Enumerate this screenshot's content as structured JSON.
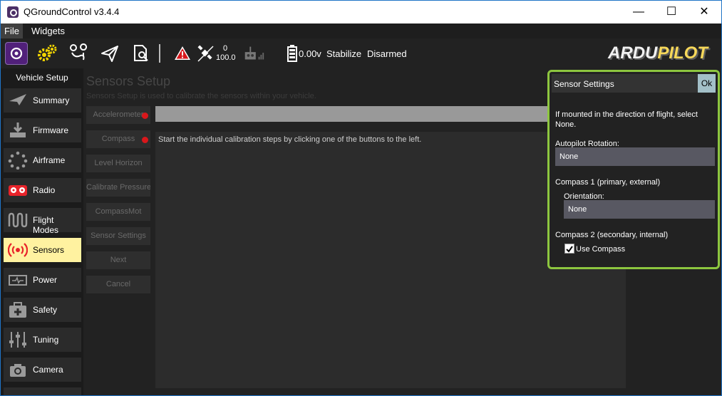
{
  "window": {
    "title": "QGroundControl v3.4.4"
  },
  "menu": {
    "items": [
      "File",
      "Widgets"
    ]
  },
  "toolbar": {
    "satellites": "0",
    "hdop": "100.0",
    "battery": "0.00v",
    "flight_mode": "Stabilize",
    "arm_state": "Disarmed",
    "brand_ardu": "ARDU",
    "brand_pilot": "PILOT"
  },
  "sidebar": {
    "header": "Vehicle Setup",
    "items": [
      {
        "label": "Summary"
      },
      {
        "label": "Firmware"
      },
      {
        "label": "Airframe"
      },
      {
        "label": "Radio"
      },
      {
        "label": "Flight Modes"
      },
      {
        "label": "Sensors"
      },
      {
        "label": "Power"
      },
      {
        "label": "Safety"
      },
      {
        "label": "Tuning"
      },
      {
        "label": "Camera"
      }
    ]
  },
  "main": {
    "title": "Sensors Setup",
    "description": "Sensors Setup is used to calibrate the sensors within your vehicle.",
    "buttons": [
      "Accelerometer",
      "Compass",
      "Level Horizon",
      "Calibrate Pressure",
      "CompassMot",
      "Sensor Settings",
      "Next",
      "Cancel"
    ],
    "status_text": "Start the individual calibration steps by clicking one of the buttons to the left."
  },
  "dialog": {
    "title": "Sensor Settings",
    "ok_label": "Ok",
    "hint": "If mounted in the direction of flight, select None.",
    "rotation_label": "Autopilot Rotation:",
    "rotation_value": "None",
    "compass1_label": "Compass 1 (primary, external)",
    "orientation_label": "Orientation:",
    "orientation_value": "None",
    "compass2_label": "Compass 2 (secondary, internal)",
    "use_compass_label": "Use Compass",
    "use_compass_checked": true
  },
  "colors": {
    "accent_yellow": "#fff2a0",
    "highlight_green": "#8dc63f",
    "alert_red": "#d9171b"
  }
}
